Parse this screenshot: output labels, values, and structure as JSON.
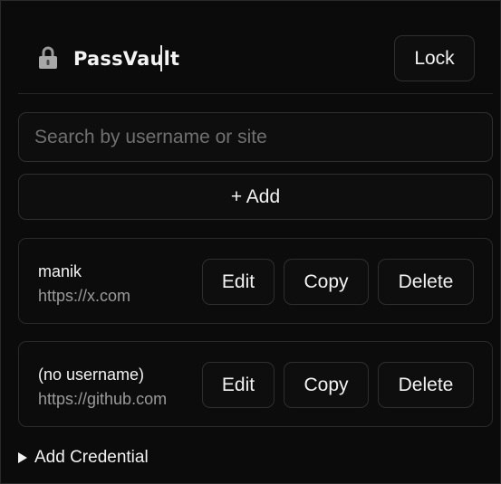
{
  "header": {
    "title": "PassVault",
    "lock_icon": "lock-icon",
    "lock_label": "Lock"
  },
  "search": {
    "placeholder": "Search by username or site",
    "value": ""
  },
  "add": {
    "label": "+ Add"
  },
  "credentials": [
    {
      "username": "manik",
      "site": "https://x.com",
      "edit_label": "Edit",
      "copy_label": "Copy",
      "delete_label": "Delete"
    },
    {
      "username": "(no username)",
      "site": "https://github.com",
      "edit_label": "Edit",
      "copy_label": "Copy",
      "delete_label": "Delete"
    }
  ],
  "details": {
    "summary_label": "Add Credential"
  },
  "colors": {
    "background": "#0b0b0b",
    "border": "#2f2f2f",
    "text": "#f2f2f2",
    "muted_text": "#9a9a9a",
    "placeholder": "#707070"
  }
}
